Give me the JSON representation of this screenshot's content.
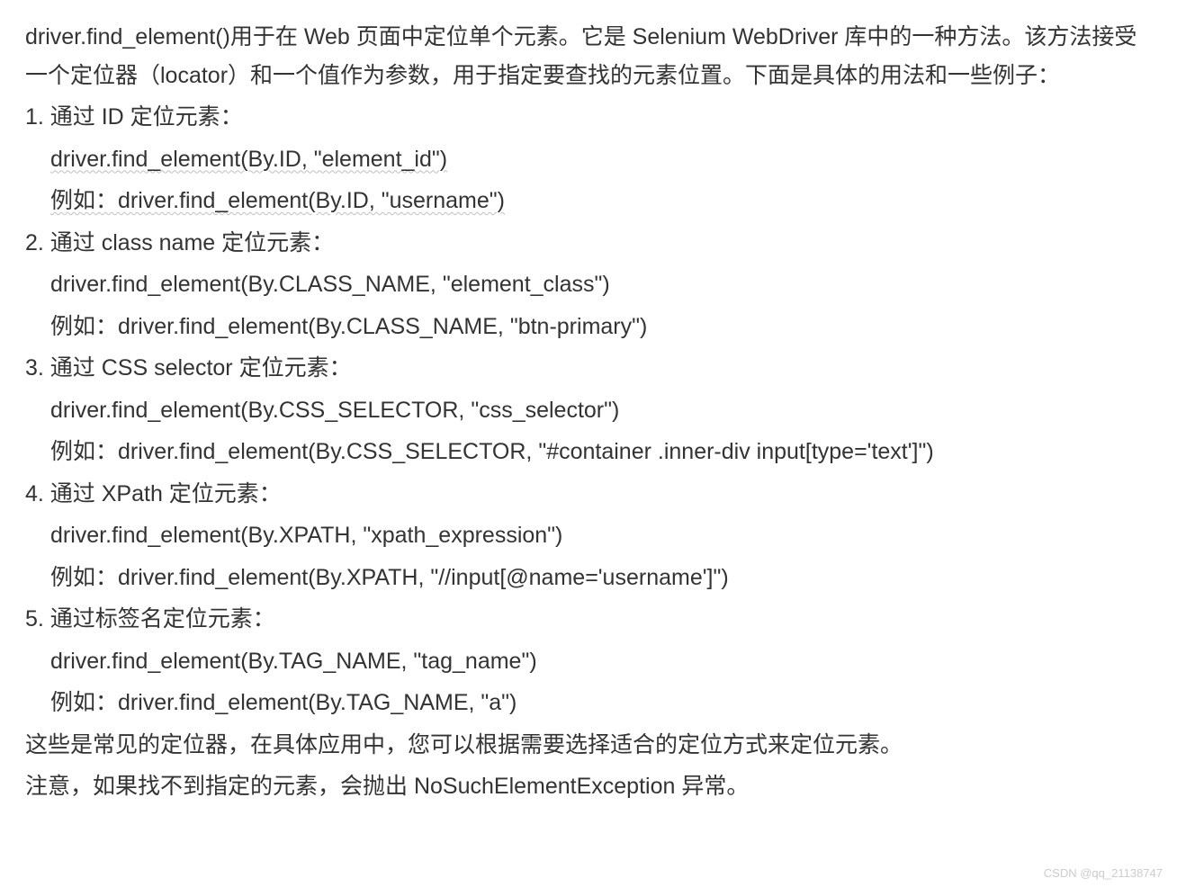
{
  "intro": "driver.find_element()用于在 Web 页面中定位单个元素。它是 Selenium WebDriver 库中的一种方法。该方法接受一个定位器（locator）和一个值作为参数，用于指定要查找的元素位置。下面是具体的用法和一些例子：",
  "sections": [
    {
      "heading": "1. 通过 ID 定位元素：",
      "code": "driver.find_element(By.ID, \"element_id\")",
      "example": "例如：driver.find_element(By.ID, \"username\")",
      "wavy": true
    },
    {
      "heading": "2. 通过 class name 定位元素：",
      "code": "driver.find_element(By.CLASS_NAME, \"element_class\")",
      "example": "例如：driver.find_element(By.CLASS_NAME, \"btn-primary\")",
      "wavy": false
    },
    {
      "heading": "3. 通过 CSS selector 定位元素：",
      "code": "driver.find_element(By.CSS_SELECTOR, \"css_selector\")",
      "example": "例如：driver.find_element(By.CSS_SELECTOR, \"#container .inner-div input[type='text']\")",
      "wavy": false
    },
    {
      "heading": "4. 通过 XPath 定位元素：",
      "code": "driver.find_element(By.XPATH, \"xpath_expression\")",
      "example": "例如：driver.find_element(By.XPATH, \"//input[@name='username']\")",
      "wavy": false
    },
    {
      "heading": "5. 通过标签名定位元素：",
      "code": "driver.find_element(By.TAG_NAME, \"tag_name\")",
      "example": "例如：driver.find_element(By.TAG_NAME, \"a\")",
      "wavy": false
    }
  ],
  "outro1": "这些是常见的定位器，在具体应用中，您可以根据需要选择适合的定位方式来定位元素。",
  "outro2": "注意，如果找不到指定的元素，会抛出 NoSuchElementException 异常。",
  "watermark": "CSDN @qq_21138747"
}
